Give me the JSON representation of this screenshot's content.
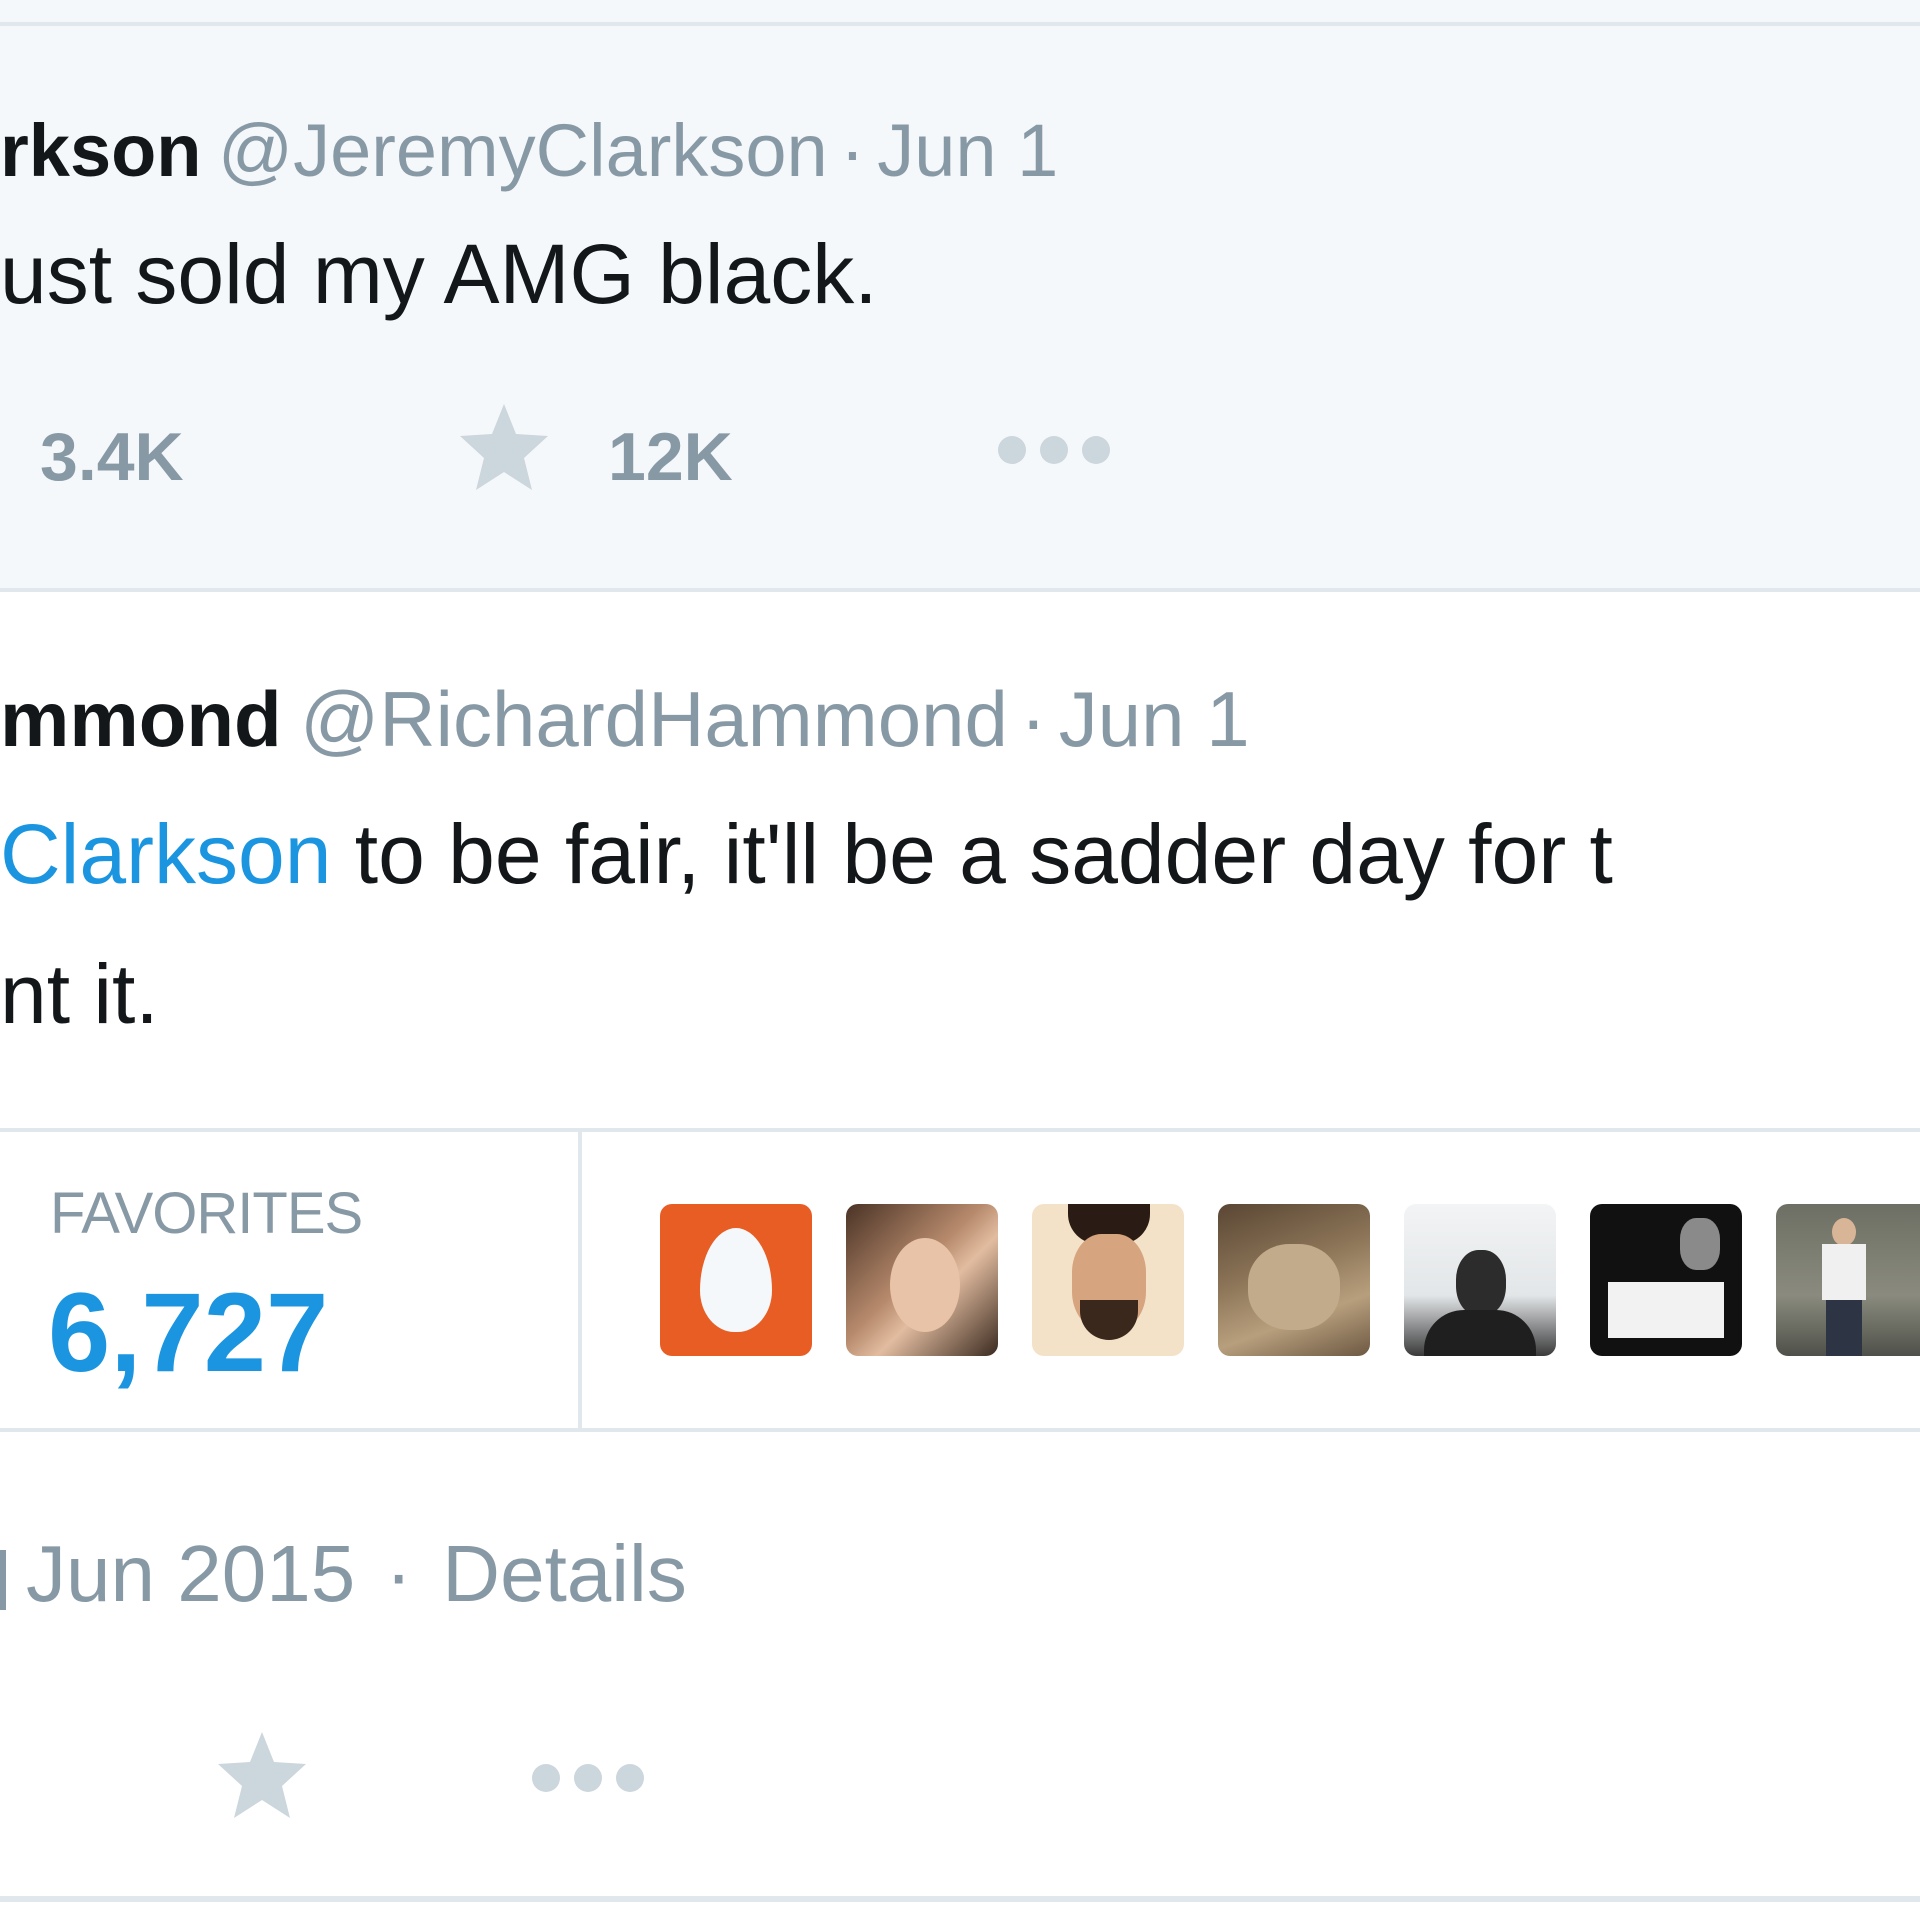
{
  "tweet1": {
    "name": "rkson",
    "handle": "@JeremyClarkson",
    "separator": "·",
    "date": "Jun 1",
    "text": "ust sold my AMG black.",
    "retweet_count": "3.4K",
    "favorite_count": "12K"
  },
  "tweet2": {
    "name": "mmond",
    "handle": "@RichardHammond",
    "separator": "·",
    "date": "Jun 1",
    "mention": "Clarkson",
    "text_line1": " to be fair, it'll be a sadder day for t",
    "text_line2": "nt it."
  },
  "stats": {
    "favorites_label": "FAVORITES",
    "favorites_count": "6,727",
    "avatars": [
      "egg-avatar",
      "woman-avatar",
      "bearded-man-avatar",
      "cat-avatar",
      "man-bw-avatar",
      "text-card-avatar",
      "standing-man-avatar"
    ]
  },
  "footer": {
    "date": "Jun 2015",
    "separator": "·",
    "details_label": "Details"
  },
  "colors": {
    "link": "#1b95e0",
    "text": "#14171a",
    "muted": "#8899a6",
    "icon": "#ccd6dd",
    "highlight_bg": "#f5f8fa",
    "border": "#e1e8ed",
    "egg_orange": "#e85d24"
  }
}
